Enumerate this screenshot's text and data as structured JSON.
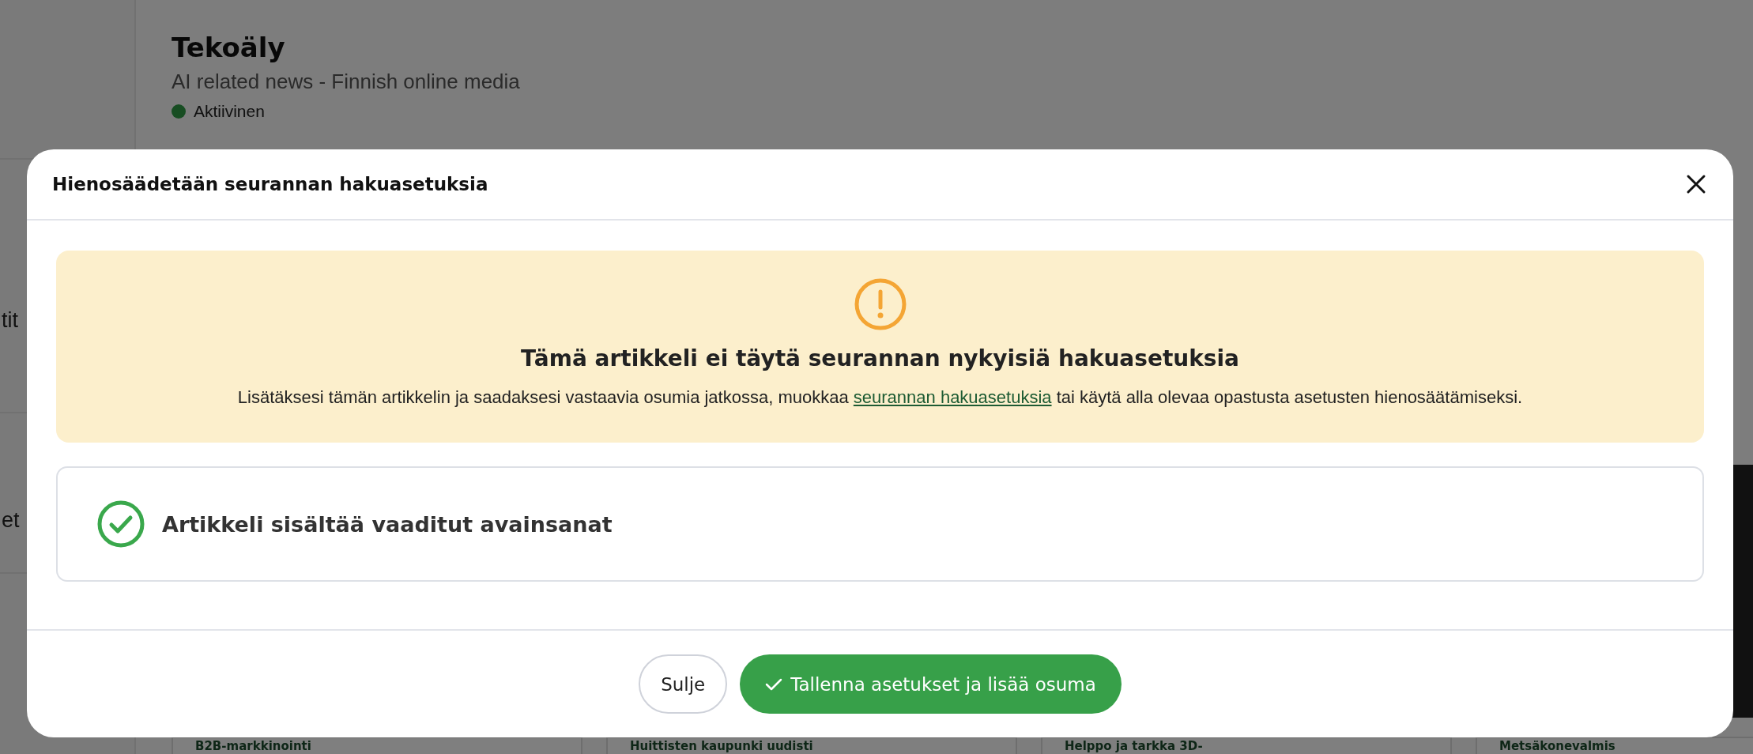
{
  "background": {
    "sidebar_items": [
      "tit",
      "et"
    ],
    "feed": {
      "title": "Tekoäly",
      "description": "AI related news - Finnish online media",
      "status": {
        "label": "Aktiivinen",
        "active": true
      }
    },
    "cards": [
      {
        "title": "B2B-markkinointi"
      },
      {
        "title": "Huittisten kaupunki uudisti"
      },
      {
        "title": "Helppo ja tarkka 3D-"
      },
      {
        "title": "Metsäkonevalmis"
      }
    ]
  },
  "dialog": {
    "title": "Hienosäädetään seurannan hakuasetuksia",
    "warning": {
      "heading": "Tämä artikkeli ei täytä seurannan nykyisiä hakuasetuksia",
      "text_before": "Lisätäksesi tämän artikkelin ja saadaksesi vastaavia osumia jatkossa, muokkaa",
      "link": "seurannan hakuasetuksia",
      "text_after": "tai käytä alla olevaa opastusta asetusten hienosäätämiseksi."
    },
    "checks": [
      {
        "label": "Artikkeli sisältää vaaditut avainsanat",
        "passed": true
      }
    ],
    "buttons": [
      {
        "label": "Sulje",
        "kind": "secondary"
      },
      {
        "label": "Tallenna asetukset ja lisää osuma",
        "kind": "primary"
      }
    ]
  }
}
